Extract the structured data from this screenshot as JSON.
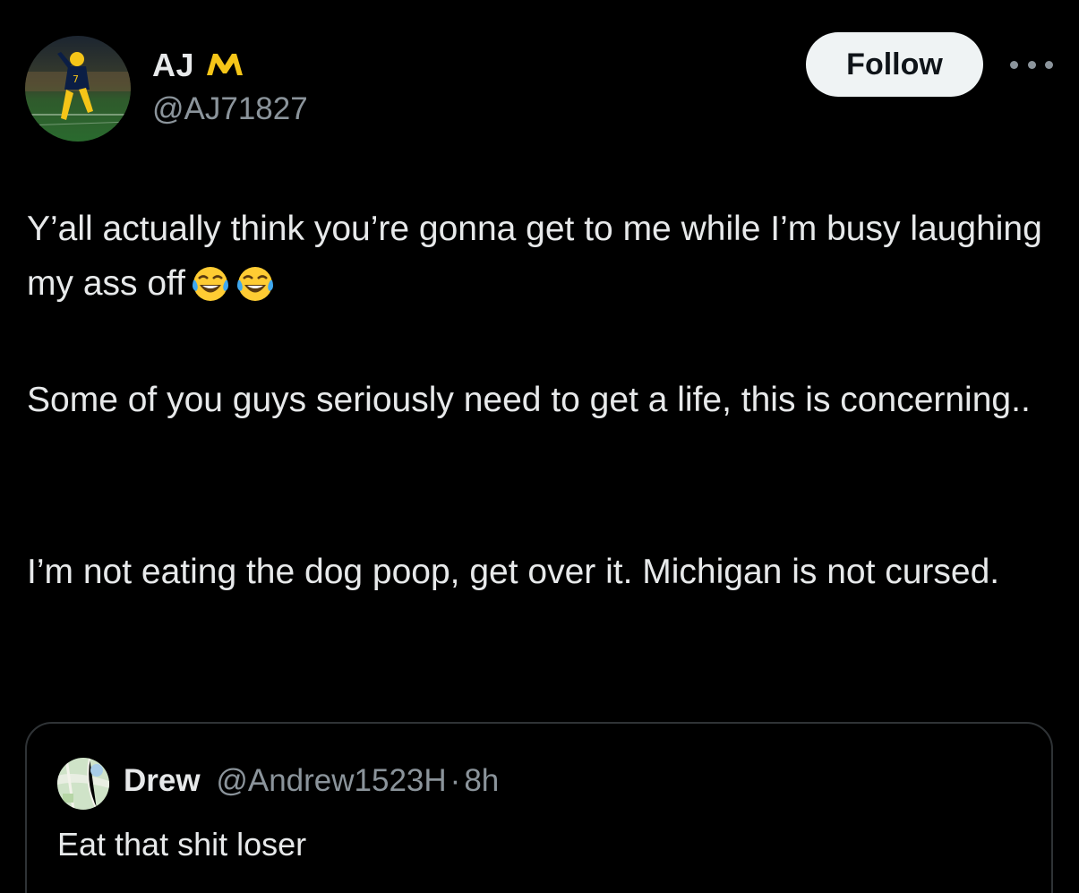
{
  "author": {
    "display_name": "AJ",
    "handle": "@AJ71827",
    "badge_icon": "michigan-wolverines-m-logo",
    "badge_color": "#f5c518"
  },
  "actions": {
    "follow_label": "Follow",
    "more_icon": "more-horizontal-icon"
  },
  "tweet": {
    "paragraph_1": "Y’all actually think you’re gonna get to me while I’m busy laughing my ass off",
    "paragraph_1_emoji": "😂😂",
    "paragraph_2": "Some of you guys seriously need to get a life, this is concerning..",
    "paragraph_3": "I’m not eating the dog poop, get over it. Michigan is not cursed."
  },
  "quoted_tweet": {
    "display_name": "Drew",
    "handle": "@Andrew1523H",
    "separator": "·",
    "time": "8h",
    "text": "Eat that shit loser"
  },
  "colors": {
    "background": "#000000",
    "text_primary": "#e7e9ea",
    "text_secondary": "#8b949b",
    "border": "#2f3336",
    "follow_bg": "#eff3f4"
  }
}
